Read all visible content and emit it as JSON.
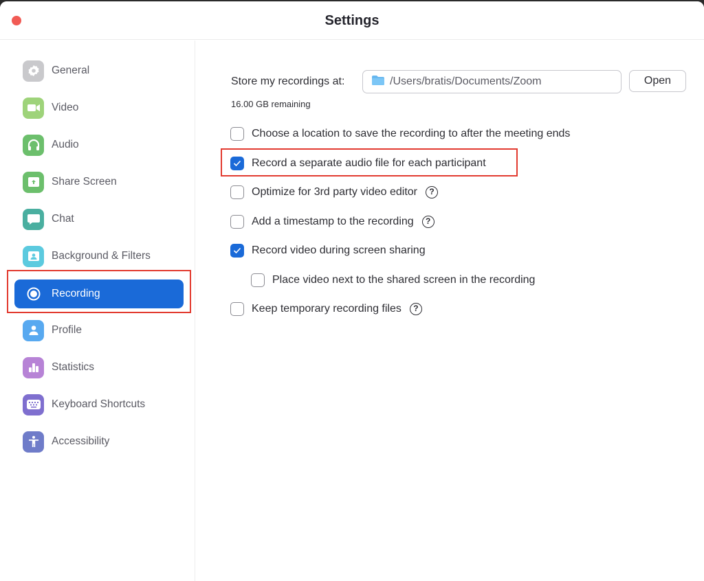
{
  "window": {
    "title": "Settings"
  },
  "sidebar": {
    "items": [
      {
        "label": "General",
        "icon": "gear-icon",
        "color": "#c9c9cc",
        "active": false
      },
      {
        "label": "Video",
        "icon": "video-camera-icon",
        "color": "#9ed37a",
        "active": false
      },
      {
        "label": "Audio",
        "icon": "headphones-icon",
        "color": "#6cbf6c",
        "active": false
      },
      {
        "label": "Share Screen",
        "icon": "share-screen-icon",
        "color": "#6cbf6c",
        "active": false
      },
      {
        "label": "Chat",
        "icon": "chat-bubble-icon",
        "color": "#4aafa0",
        "active": false
      },
      {
        "label": "Background & Filters",
        "icon": "background-person-icon",
        "color": "#5ccadf",
        "active": false
      },
      {
        "label": "Recording",
        "icon": "record-icon",
        "color": "#ffffff",
        "active": true
      },
      {
        "label": "Profile",
        "icon": "profile-person-icon",
        "color": "#58a9f0",
        "active": false
      },
      {
        "label": "Statistics",
        "icon": "bar-chart-icon",
        "color": "#b783d6",
        "active": false
      },
      {
        "label": "Keyboard Shortcuts",
        "icon": "keyboard-icon",
        "color": "#7f6fcf",
        "active": false
      },
      {
        "label": "Accessibility",
        "icon": "accessibility-icon",
        "color": "#6f7cc9",
        "active": false
      }
    ]
  },
  "recording": {
    "store_label": "Store my recordings at:",
    "path_value": "/Users/bratis/Documents/Zoom",
    "open_label": "Open",
    "remaining": "16.00 GB remaining",
    "options": [
      {
        "label": "Choose a location to save the recording to after the meeting ends",
        "checked": false,
        "help": false,
        "indent": false
      },
      {
        "label": "Record a separate audio file for each participant",
        "checked": true,
        "help": false,
        "indent": false
      },
      {
        "label": "Optimize for 3rd party video editor",
        "checked": false,
        "help": true,
        "indent": false
      },
      {
        "label": "Add a timestamp to the recording",
        "checked": false,
        "help": true,
        "indent": false
      },
      {
        "label": "Record video during screen sharing",
        "checked": true,
        "help": false,
        "indent": false
      },
      {
        "label": "Place video next to the shared screen in the recording",
        "checked": false,
        "help": false,
        "indent": true
      },
      {
        "label": "Keep temporary recording files",
        "checked": false,
        "help": true,
        "indent": false
      }
    ],
    "help_glyph": "?"
  },
  "colors": {
    "accent": "#1a6ad8",
    "highlight": "#e23a2f",
    "close": "#f15b55"
  }
}
